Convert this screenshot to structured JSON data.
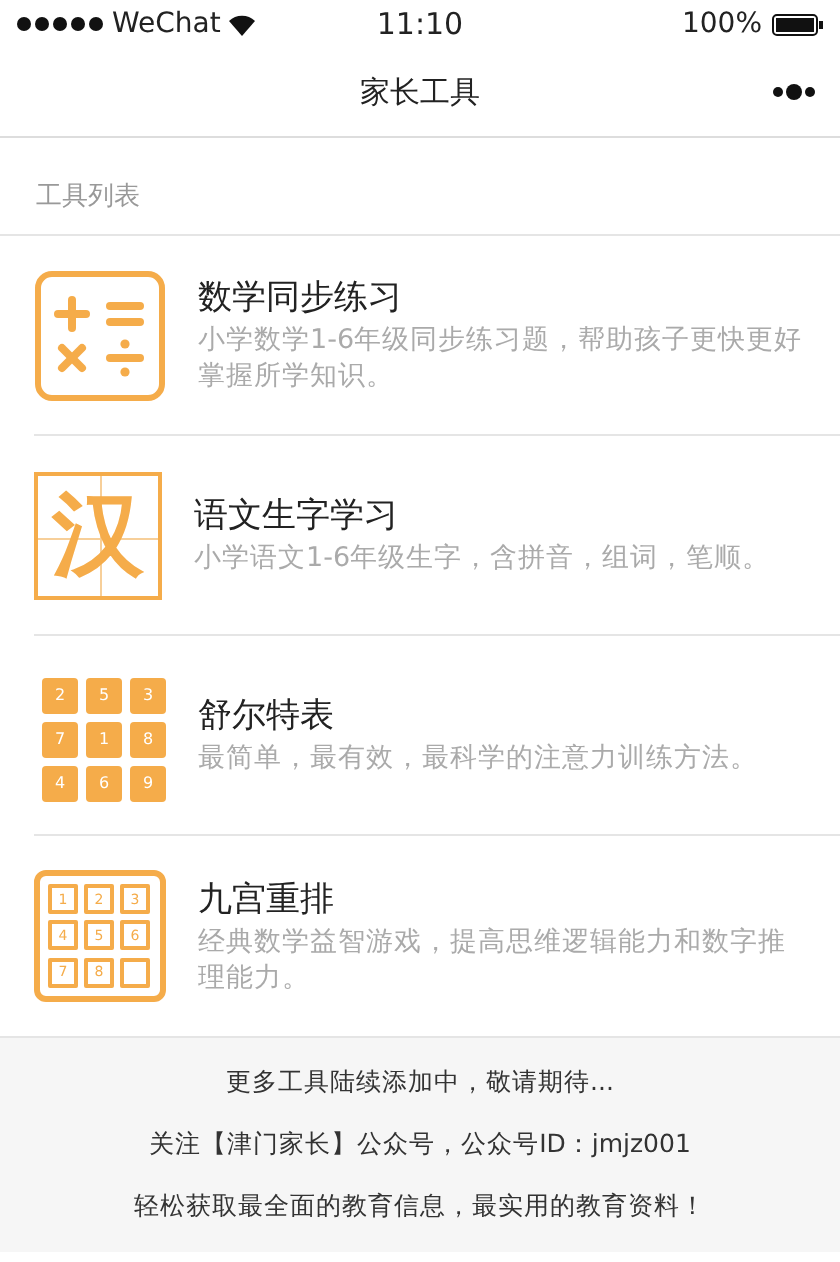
{
  "status_bar": {
    "carrier": "WeChat",
    "time": "11:10",
    "battery": "100%"
  },
  "nav_bar": {
    "title": "家长工具"
  },
  "section": {
    "title": "工具列表"
  },
  "tools": [
    {
      "kind": "calculator",
      "title": "数学同步练习",
      "description": "小学数学1-6年级同步练习题，帮助孩子更快更好掌握所学知识。"
    },
    {
      "kind": "character",
      "glyph": "汉",
      "title": "语文生字学习",
      "description": "小学语文1-6年级生字，含拼音，组词，笔顺。"
    },
    {
      "kind": "schulte",
      "cells": [
        "2",
        "5",
        "3",
        "7",
        "1",
        "8",
        "4",
        "6",
        "9"
      ],
      "title": "舒尔特表",
      "description": "最简单，最有效，最科学的注意力训练方法。"
    },
    {
      "kind": "nine-grid",
      "cells": [
        "1",
        "2",
        "3",
        "4",
        "5",
        "6",
        "7",
        "8"
      ],
      "title": "九宫重排",
      "description": "经典数学益智游戏，提高思维逻辑能力和数字推理能力。"
    }
  ],
  "footer": [
    "更多工具陆续添加中，敬请期待...",
    "关注【津门家长】公众号，公众号ID：jmjz001",
    "轻松获取最全面的教育信息，最实用的教育资料！"
  ]
}
